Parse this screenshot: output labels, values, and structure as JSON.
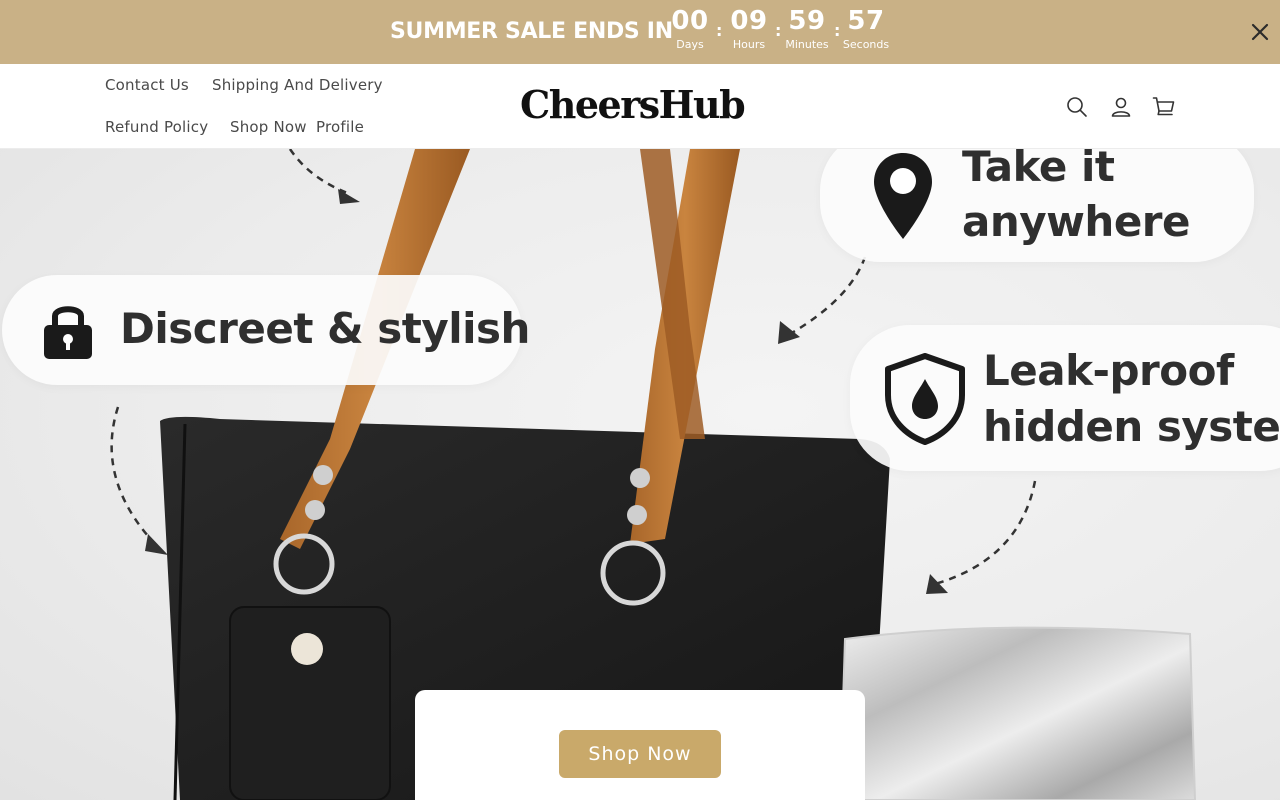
{
  "announcement": {
    "text": "SUMMER SALE ENDS IN",
    "timer": [
      {
        "value": "00",
        "label": "Days"
      },
      {
        "value": "09",
        "label": "Hours"
      },
      {
        "value": "59",
        "label": "Minutes"
      },
      {
        "value": "57",
        "label": "Seconds"
      }
    ],
    "separator": ":",
    "close_icon": "close-icon",
    "background": "#c9b186"
  },
  "header": {
    "nav": [
      {
        "label": "Contact Us"
      },
      {
        "label": "Shipping And Delivery"
      },
      {
        "label": "Refund Policy"
      },
      {
        "label": "Shop Now"
      },
      {
        "label": "Profile"
      }
    ],
    "logo": "CheersHub",
    "icons": [
      "search-icon",
      "account-icon",
      "cart-icon"
    ]
  },
  "hero": {
    "features": [
      {
        "text": "Discreet & stylish",
        "icon": "lock-icon"
      },
      {
        "line1": "Take it",
        "line2": "anywhere",
        "icon": "location-pin-icon"
      },
      {
        "line1": "Leak-proof",
        "line2": "hidden system",
        "icon": "shield-drop-icon"
      }
    ],
    "cta_label": "Shop Now",
    "cta_color": "#c9a96a"
  }
}
